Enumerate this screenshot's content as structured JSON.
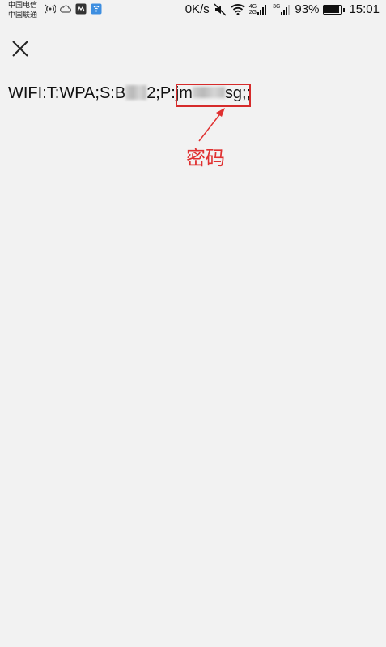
{
  "status_bar": {
    "carrier_1": "中国电信",
    "carrier_2": "中国联通",
    "net_speed": "0K/s",
    "signal_1_tag_top": "4G",
    "signal_1_tag_bottom": "2G",
    "signal_2_tag": "3G",
    "battery_percent": "93%",
    "battery_level": 0.93,
    "time": "15:01"
  },
  "toolbar": {
    "close_icon": "close-icon"
  },
  "content": {
    "prefix": "WIFI:T:WPA;S:B",
    "ssid_tail": "2;P:",
    "password_head": "jm",
    "password_tail": "sg",
    "suffix": ";;"
  },
  "annotation": {
    "label": "密码",
    "color": "#e03030"
  }
}
